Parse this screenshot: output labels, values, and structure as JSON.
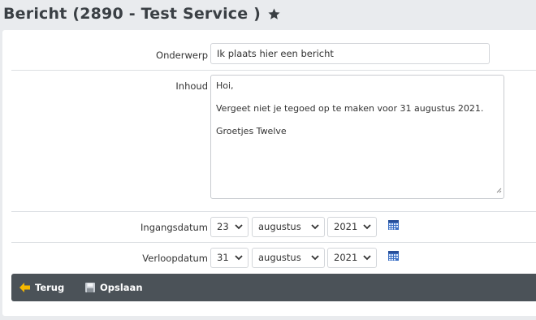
{
  "header": {
    "title": "Bericht (2890 - Test Service )",
    "favorite_icon": "star-icon"
  },
  "form": {
    "subject": {
      "label": "Onderwerp",
      "value": "Ik plaats hier een bericht"
    },
    "content": {
      "label": "Inhoud",
      "lines": [
        "Hoi,",
        "Vergeet niet je tegoed op te maken voor 31 augustus 2021.",
        "Groetjes Twelve"
      ]
    },
    "start_date": {
      "label": "Ingangsdatum",
      "day": "23",
      "month": "augustus",
      "year": "2021",
      "icon": "calendar-icon"
    },
    "end_date": {
      "label": "Verloopdatum",
      "day": "31",
      "month": "augustus",
      "year": "2021",
      "icon": "calendar-icon"
    }
  },
  "toolbar": {
    "back_label": "Terug",
    "back_icon": "arrow-left-icon",
    "save_label": "Opslaan",
    "save_icon": "floppy-disk-icon"
  },
  "colors": {
    "toolbar_bg": "#4b5258",
    "background": "#e9ebee",
    "back_arrow": "#f5b800",
    "calendar": "#3b6fc4"
  }
}
